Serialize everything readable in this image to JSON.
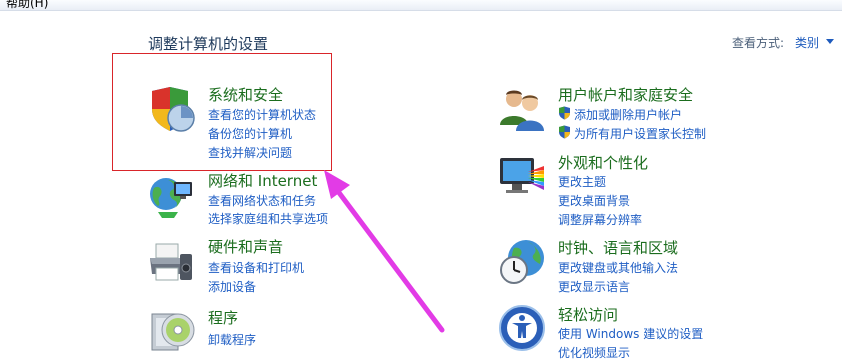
{
  "menu": {
    "help": "帮助(H)"
  },
  "header": {
    "title": "调整计算机的设置",
    "view_by_label": "查看方式:",
    "view_by_value": "类别"
  },
  "categories": {
    "security": {
      "title": "系统和安全",
      "links": [
        "查看您的计算机状态",
        "备份您的计算机",
        "查找并解决问题"
      ]
    },
    "network": {
      "title": "网络和 Internet",
      "links": [
        "查看网络状态和任务",
        "选择家庭组和共享选项"
      ]
    },
    "hardware": {
      "title": "硬件和声音",
      "links": [
        "查看设备和打印机",
        "添加设备"
      ]
    },
    "programs": {
      "title": "程序",
      "links": [
        "卸载程序"
      ]
    },
    "users": {
      "title": "用户帐户和家庭安全",
      "links": [
        "添加或删除用户帐户",
        "为所有用户设置家长控制"
      ]
    },
    "appearance": {
      "title": "外观和个性化",
      "links": [
        "更改主题",
        "更改桌面背景",
        "调整屏幕分辨率"
      ]
    },
    "clock": {
      "title": "时钟、语言和区域",
      "links": [
        "更改键盘或其他输入法",
        "更改显示语言"
      ]
    },
    "access": {
      "title": "轻松访问",
      "links": [
        "使用 Windows 建议的设置",
        "优化视频显示"
      ]
    }
  },
  "colors": {
    "category_title": "#1b6d1e",
    "link": "#1f5ec4",
    "highlight_box": "#d9252a",
    "annotation_arrow": "#e23be6"
  },
  "icons": {
    "security": "security-shield-icon",
    "network": "network-globe-icon",
    "hardware": "printer-icon",
    "programs": "programs-disc-icon",
    "users": "users-icon",
    "appearance": "appearance-monitor-icon",
    "clock": "clock-globe-icon",
    "access": "ease-of-access-icon",
    "uac": "uac-shield-icon"
  }
}
